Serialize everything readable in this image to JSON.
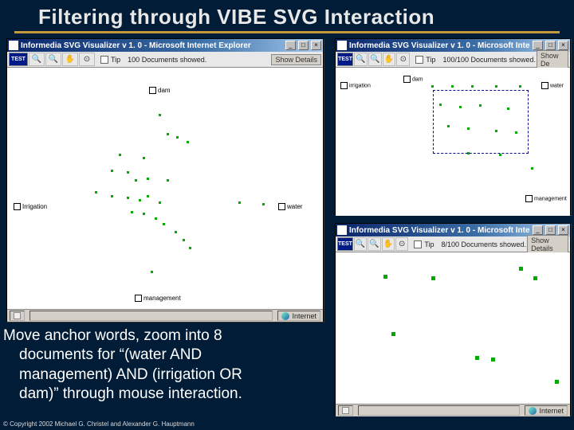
{
  "slide": {
    "title": "Filtering through VIBE SVG Interaction",
    "caption_line1": "Move anchor words, zoom into 8",
    "caption_line2": "documents for “(water AND",
    "caption_line3": "management) AND (irrigation OR",
    "caption_line4": "dam)” through mouse interaction.",
    "copyright": "© Copyright 2002 Michael G. Christel and Alexander G. Hauptmann"
  },
  "common": {
    "app_title": "Informedia SVG Visualizer v 1. 0 - Microsoft Internet Explorer",
    "tip_label": "Tip",
    "show_details": "Show Details",
    "show_details_short": "Show De",
    "internet": "Internet",
    "badge": "TEST",
    "btn_min": "_",
    "btn_max": "□",
    "btn_close": "×"
  },
  "win1": {
    "docs": "100    Documents showed.",
    "anchors": {
      "dam": "dam",
      "irrigation": "Irrigation",
      "water": "water",
      "management": "management"
    }
  },
  "win2": {
    "docs": "100/100  Documents showed.",
    "anchors": {
      "dam": "dam",
      "irrigation": "irrigation",
      "water": "water",
      "management": "management"
    }
  },
  "win3": {
    "docs": "8/100   Documents showed."
  }
}
